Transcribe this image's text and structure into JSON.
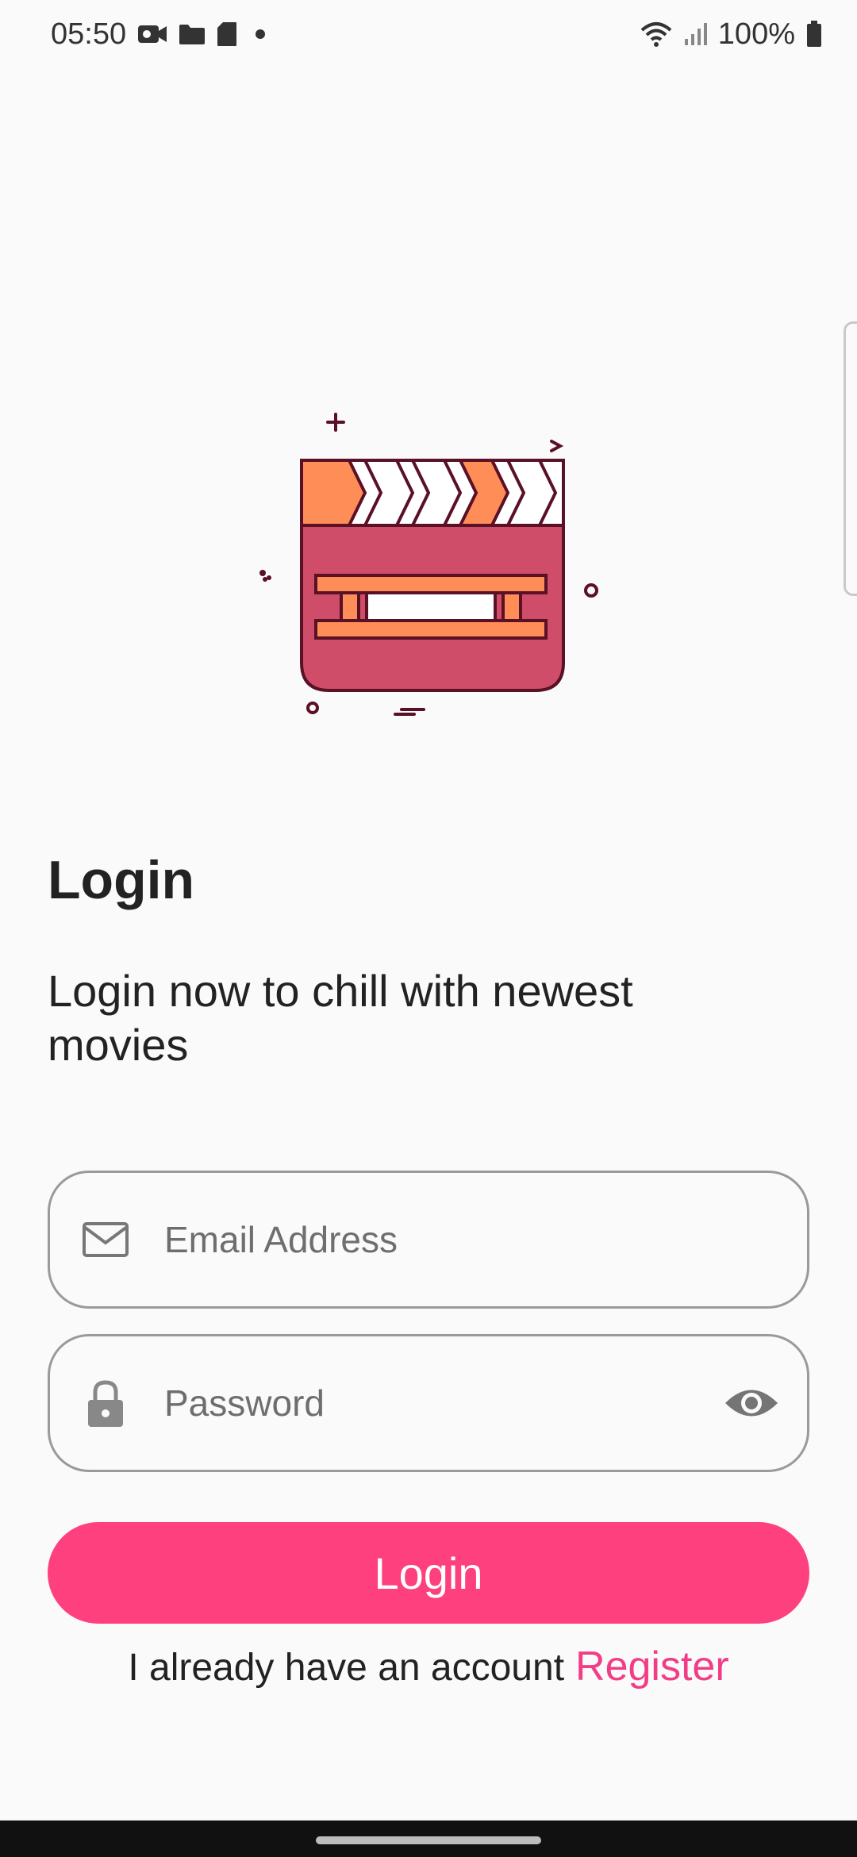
{
  "status_bar": {
    "time": "05:50",
    "battery": "100%",
    "icons": [
      "video-icon",
      "folder-icon",
      "sd-card-icon",
      "dot-icon",
      "wifi-icon",
      "signal-icon",
      "battery-icon"
    ]
  },
  "illustration": {
    "icon": "clapperboard-icon",
    "colors": {
      "board": "#cf4d69",
      "stripe": "#ff8d57",
      "outline": "#5a1025"
    }
  },
  "login": {
    "title": "Login",
    "subtitle": "Login now to chill with newest movies",
    "email_placeholder": "Email Address",
    "email_value": "",
    "password_placeholder": "Password",
    "password_value": "",
    "button_label": "Login",
    "footer_text": "I already have an account",
    "register_label": "Register"
  },
  "colors": {
    "accent": "#ff407f",
    "link": "#f23d86",
    "field_border": "#9a9a9a"
  }
}
